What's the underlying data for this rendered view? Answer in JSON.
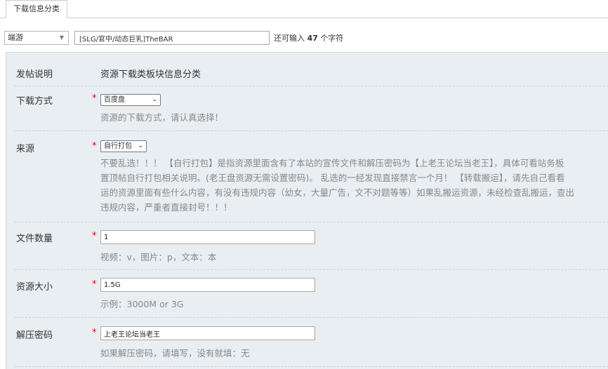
{
  "tab": {
    "label": "下载信息分类"
  },
  "header": {
    "category_select": "端游",
    "title_value": "[SLG/官中/动态巨乳]TheBAR",
    "counter_prefix": "还可输入",
    "counter_num": "47",
    "counter_suffix": "个字符"
  },
  "form": {
    "intro": {
      "label": "发帖说明",
      "value": "资源下载类板块信息分类"
    },
    "download": {
      "label": "下载方式",
      "star": "*",
      "selected": "百度盘",
      "desc": "资源的下载方式，请认真选择！"
    },
    "source": {
      "label": "来源",
      "star": "*",
      "selected": "自行打包",
      "desc_lines": [
        "不要乱选！！！ 【自行打包】是指资源里面含有了本站的宣传文件和解压密码为【上老王论坛当老王】，具体可看站务板",
        "置顶帖自行打包相关说明。(老王盘资源无需设置密码)。 乱选的一经发现直接禁言一个月！ 【转载搬运】，请先自己看看",
        "运的资源里面有些什么内容，有没有违规内容（幼女，大量广告，文不对题等等）如果乱搬运资源，未经检查乱搬运，查出",
        "违规内容，严重者直接封号！！！"
      ]
    },
    "file_count": {
      "label": "文件数量",
      "star": "*",
      "value": "1",
      "desc": "视频：v，图片：p，文本：本"
    },
    "size": {
      "label": "资源大小",
      "star": "*",
      "value": "1.5G",
      "desc": "示例：3000M or 3G"
    },
    "password": {
      "label": "解压密码",
      "star": "*",
      "value": "上老王论坛当老王",
      "desc": "如果解压密码，请填写，没有就填：无"
    }
  }
}
